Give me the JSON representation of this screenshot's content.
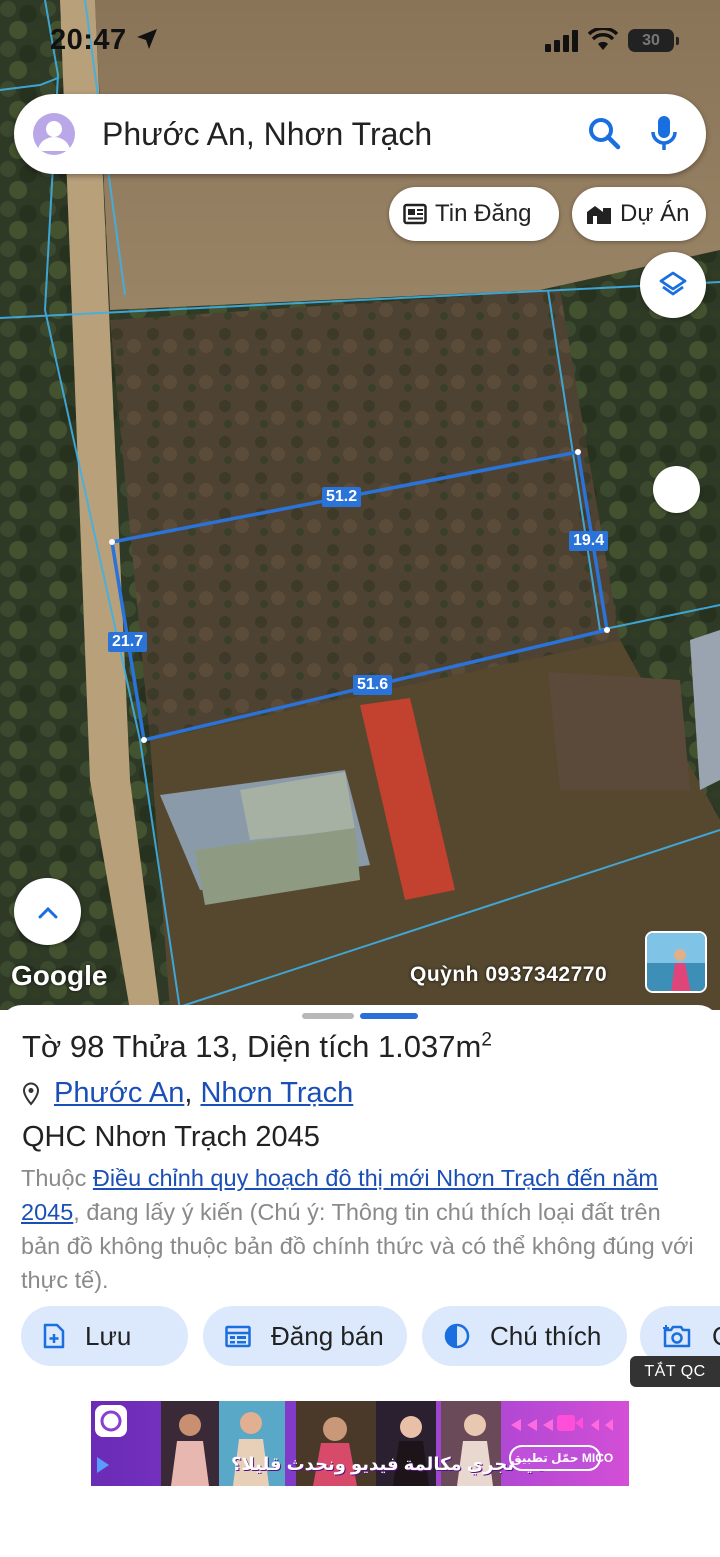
{
  "status_bar": {
    "time": "20:47",
    "battery": "30"
  },
  "search": {
    "query": "Phước An, Nhơn Trạch"
  },
  "map": {
    "chips": [
      {
        "label": "Tin Đăng",
        "icon": "newspaper-icon"
      },
      {
        "label": "Dự Án",
        "icon": "buildings-icon"
      }
    ],
    "dimensions": {
      "top": "51.2",
      "right": "19.4",
      "left": "21.7",
      "bottom": "51.6"
    },
    "attribution": "Google",
    "contact": "Quỳnh 0937342770"
  },
  "parcel": {
    "title_prefix": "Tờ",
    "sheet_no": "98",
    "parcel_word": "Thửa",
    "parcel_no": "13",
    "area_label": "Diện tích",
    "area_value": "1.037m",
    "area_sup": "2",
    "ward": "Phước An",
    "district": "Nhơn Trạch",
    "plan": "QHC Nhơn Trạch 2045",
    "desc_prefix": "Thuộc",
    "desc_link": "Điều chỉnh quy hoạch đô thị mới Nhơn Trạch đến năm 2045",
    "desc_suffix": ", đang lấy ý kiến (Chú ý: Thông tin chú thích loại đất trên bản đồ không thuộc bản đồ chính thức và có thể không đúng với thực tế)."
  },
  "actions": [
    {
      "label": "Lưu",
      "icon": "save-doc-icon"
    },
    {
      "label": "Đăng bán",
      "icon": "listing-icon"
    },
    {
      "label": "Chú thích",
      "icon": "contrast-icon"
    },
    {
      "label": "C",
      "icon": "camera-icon"
    }
  ],
  "ad": {
    "close_label": "TẮT QC",
    "text": "هيا نجري مكالمة فيديو ونحدث قليلا؟",
    "brand": "حمّل تطبيق MICO"
  },
  "colors": {
    "accent": "#2a6fd8",
    "parcel_line": "#2a73d9",
    "button_bg": "#dce8fb",
    "link": "#1a4fb8"
  }
}
